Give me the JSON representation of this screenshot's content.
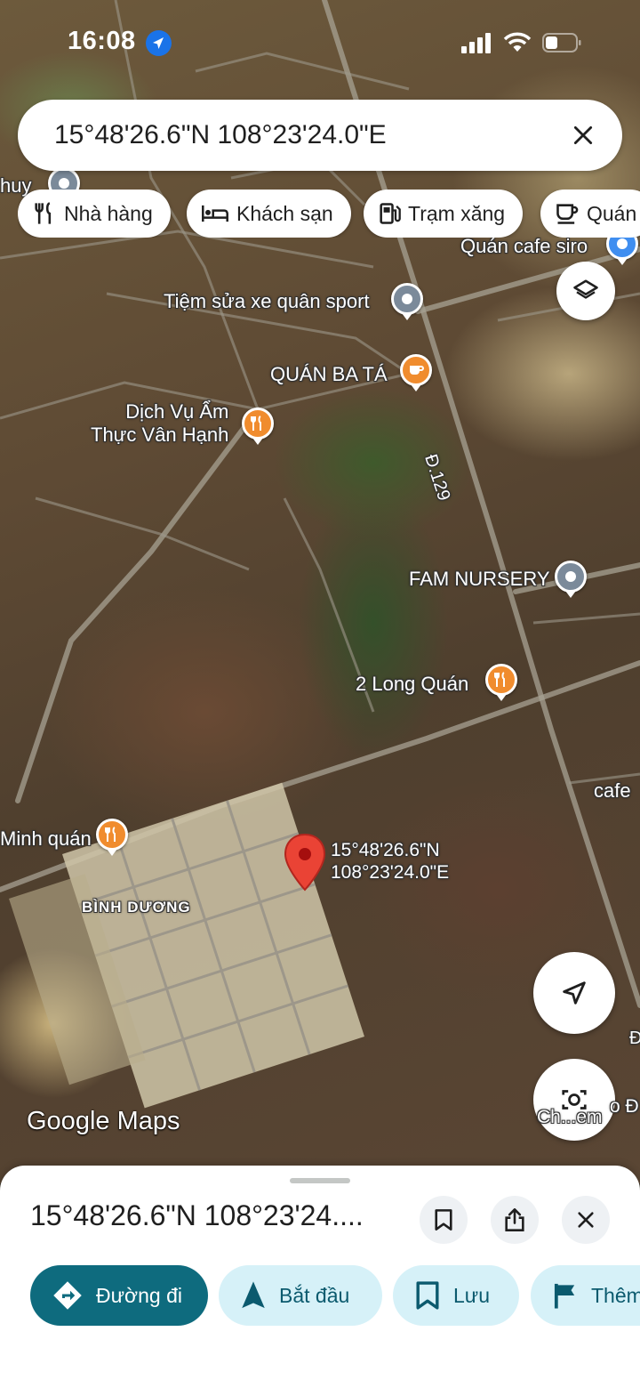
{
  "status_bar": {
    "time": "16:08"
  },
  "search": {
    "query": "15°48'26.6\"N 108°23'24.0\"E"
  },
  "chips": [
    {
      "icon": "restaurant-icon",
      "label": "Nhà hàng"
    },
    {
      "icon": "hotel-icon",
      "label": "Khách sạn"
    },
    {
      "icon": "gas-station-icon",
      "label": "Trạm xăng"
    },
    {
      "icon": "cafe-icon",
      "label": "Quán"
    }
  ],
  "map": {
    "labels": {
      "huy": "huy",
      "cafe_siro": "Quán cafe siro",
      "tiem_sua_xe": "Tiệm sửa xe quân sport",
      "quan_ba_ta": "QUÁN BA TÁ",
      "dich_vu_line1": "Dịch Vụ Ẩm",
      "dich_vu_line2": "Thực Vân Hạnh",
      "road_129": "Đ.129",
      "fam_nursery": "FAM NURSERY",
      "long_quan": "2 Long Quán",
      "cafe": "cafe",
      "minh_quan": "Minh quán",
      "binh_duong": "BÌNH DƯƠNG",
      "pin_lat": "15°48'26.6\"N",
      "pin_lng": "108°23'24.0\"E",
      "road_d": "Đ",
      "ch_em_line": "Ch...em",
      "o_d": "o Đ"
    },
    "logo": "Google Maps"
  },
  "sheet": {
    "title": "15°48'26.6\"N 108°23'24....",
    "actions": [
      {
        "icon": "directions-icon",
        "label": "Đường đi"
      },
      {
        "icon": "navigate-start-icon",
        "label": "Bắt đầu"
      },
      {
        "icon": "bookmark-icon",
        "label": "Lưu"
      },
      {
        "icon": "flag-icon",
        "label": "Thêm"
      }
    ]
  },
  "colors": {
    "primary_action": "#0e6b7e",
    "chip_bg": "#d6f1f8",
    "pin_red": "#ea4335"
  }
}
